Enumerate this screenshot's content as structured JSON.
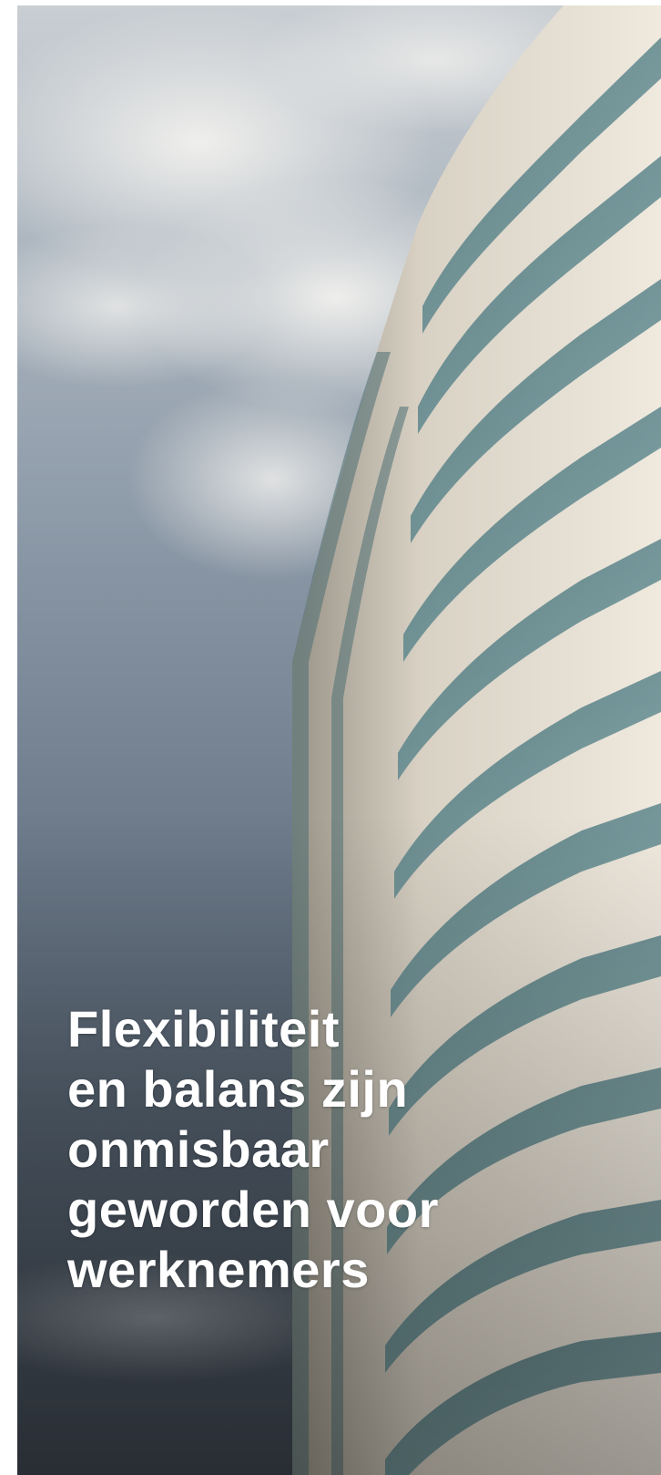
{
  "hero": {
    "headline_lines": [
      "Flexibiliteit",
      "en balans zijn",
      "onmisbaar",
      "geworden voor",
      "werknemers"
    ]
  },
  "colors": {
    "headline_text": "#ffffff",
    "facade_panel": "#e3ddd3",
    "window_glass": "#5f8a8f"
  }
}
